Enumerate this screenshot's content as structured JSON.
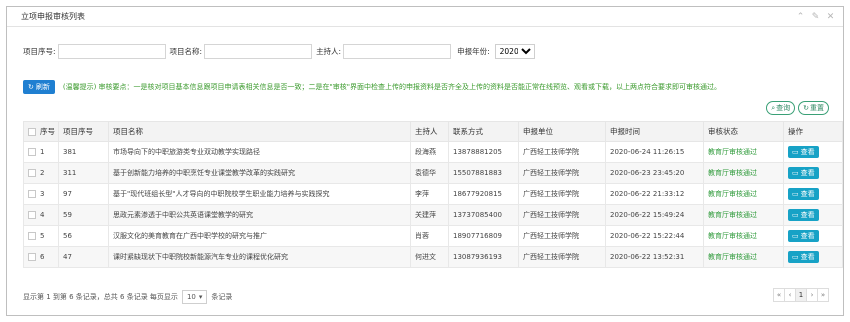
{
  "panel": {
    "title": "立项申报审核列表"
  },
  "search": {
    "project_no_label": "项目序号:",
    "project_no_value": "",
    "project_name_label": "项目名称:",
    "project_name_value": "",
    "host_label": "主持人:",
    "host_value": "",
    "year_label": "申报年份:",
    "year_value": "2020"
  },
  "toolbar": {
    "refresh_label": "刷新",
    "notice": "(温馨提示) 审核要点：一是核对项目基本信息跟项目申请表相关信息是否一致；二是在\"审核\"界面中检查上传的申报资料是否齐全及上传的资料是否能正常在线预览、观看或下载，以上两点符合要求即可审核通过。",
    "query_label": "查询",
    "reset_label": "重置"
  },
  "table": {
    "headers": [
      "序号",
      "项目序号",
      "项目名称",
      "主持人",
      "联系方式",
      "申报单位",
      "申报时间",
      "审核状态",
      "操作"
    ],
    "rows": [
      {
        "idx": "1",
        "no": "381",
        "name": "市场导向下的中职旅游类专业双动教学实现路径",
        "host": "段海燕",
        "phone": "13878881205",
        "unit": "广西轻工技师学院",
        "time": "2020-06-24 11:26:15",
        "status": "教育厅审核通过",
        "action": "查看"
      },
      {
        "idx": "2",
        "no": "311",
        "name": "基于创新能力培养的中职烹饪专业课堂教学改革的实践研究",
        "host": "袁德华",
        "phone": "15507881883",
        "unit": "广西轻工技师学院",
        "time": "2020-06-23 23:45:20",
        "status": "教育厅审核通过",
        "action": "查看"
      },
      {
        "idx": "3",
        "no": "97",
        "name": "基于\"现代班组长型\"人才导向的中职院校学生职业能力培养与实践探究",
        "host": "李萍",
        "phone": "18677920815",
        "unit": "广西轻工技师学院",
        "time": "2020-06-22 21:33:12",
        "status": "教育厅审核通过",
        "action": "查看"
      },
      {
        "idx": "4",
        "no": "59",
        "name": "思政元素渗透于中职公共英语课堂教学的研究",
        "host": "关建萍",
        "phone": "13737085400",
        "unit": "广西轻工技师学院",
        "time": "2020-06-22 15:49:24",
        "status": "教育厅审核通过",
        "action": "查看"
      },
      {
        "idx": "5",
        "no": "56",
        "name": "汉服文化的美育教育在广西中职学校的研究与推广",
        "host": "肖蓉",
        "phone": "18907716809",
        "unit": "广西轻工技师学院",
        "time": "2020-06-22 15:22:44",
        "status": "教育厅审核通过",
        "action": "查看"
      },
      {
        "idx": "6",
        "no": "47",
        "name": "课时紧缺现状下中职院校新能源汽车专业的课程优化研究",
        "host": "何进文",
        "phone": "13087936193",
        "unit": "广西轻工技师学院",
        "time": "2020-06-22 13:52:31",
        "status": "教育厅审核通过",
        "action": "查看"
      }
    ]
  },
  "footer": {
    "summary": "显示第 1 到第 6 条记录，总共 6 条记录 每页显示",
    "page_size": "10",
    "unit": "条记录"
  },
  "pager": {
    "first": "«",
    "prev": "‹",
    "current": "1",
    "next": "›",
    "last": "»"
  },
  "icons": {
    "window_tools": [
      "chevron-up-icon",
      "wrench-icon",
      "close-icon"
    ],
    "refresh": "refresh-icon",
    "query": "search-icon",
    "reset": "reset-icon",
    "view": "folder-icon"
  },
  "colors": {
    "primary": "#1f7fd1",
    "notice": "#3a9a2c",
    "status": "#2e9a3a",
    "view_button": "#17a2c6"
  }
}
